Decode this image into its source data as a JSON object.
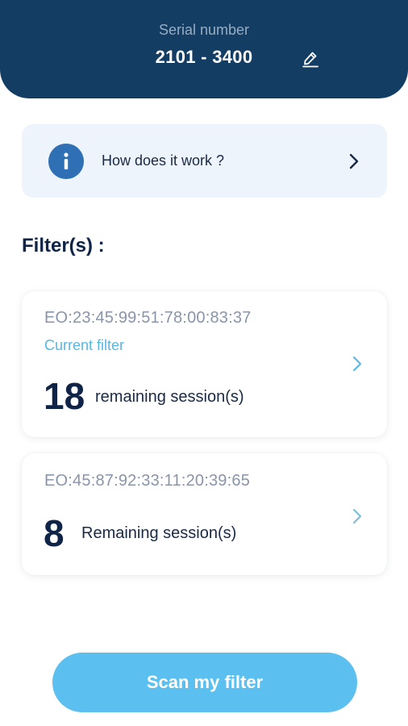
{
  "header": {
    "serial_label": "Serial number",
    "serial_value": "2101 - 3400",
    "edit_icon": "pencil-icon"
  },
  "info": {
    "label": "How does it work ?",
    "icon": "info-icon",
    "chevron": "chevron-right-icon"
  },
  "filters_section": {
    "title": "Filter(s) :"
  },
  "filters": [
    {
      "id": "EO:23:45:99:51:78:00:83:37",
      "tag": "Current filter",
      "sessions": "18",
      "sessions_label": "remaining session(s)"
    },
    {
      "id": "EO:45:87:92:33:11:20:39:65",
      "sessions": "8",
      "sessions_label": "Remaining session(s)"
    }
  ],
  "actions": {
    "scan_label": "Scan my filter"
  },
  "colors": {
    "header_bg": "#133d63",
    "info_bg": "#eef4fb",
    "info_icon_bg": "#2f6fb3",
    "accent": "#5bc0ef",
    "current_tag": "#5ab7e3",
    "dark_text": "#0f2447"
  }
}
